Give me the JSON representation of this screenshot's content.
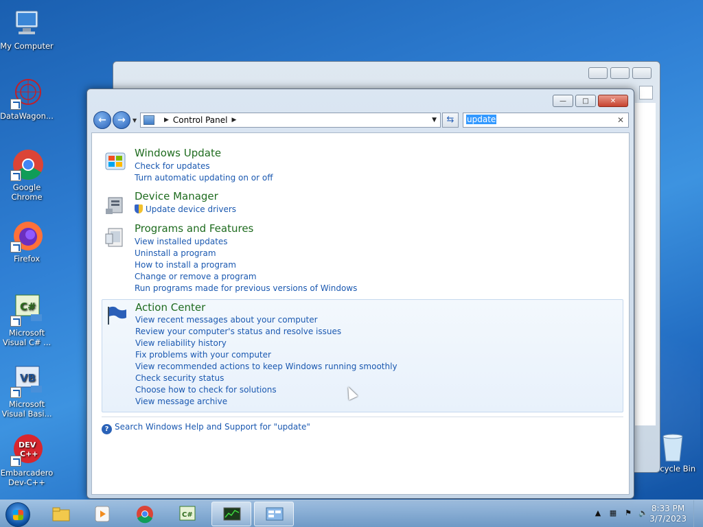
{
  "desktop": {
    "icons": [
      {
        "label": "My Computer"
      },
      {
        "label": "DataWagon..."
      },
      {
        "label": "Google Chrome"
      },
      {
        "label": "Firefox"
      },
      {
        "label": "Microsoft Visual C# ..."
      },
      {
        "label": "Microsoft Visual Basi..."
      },
      {
        "label": "Embarcadero Dev-C++"
      }
    ],
    "recycle_bin": "Recycle Bin"
  },
  "window": {
    "address": {
      "location": "Control Panel"
    },
    "search": {
      "value": "update"
    },
    "groups": [
      {
        "title": "Windows Update",
        "links": [
          "Check for updates",
          "Turn automatic updating on or off"
        ]
      },
      {
        "title": "Device Manager",
        "links": [
          "Update device drivers"
        ]
      },
      {
        "title": "Programs and Features",
        "links": [
          "View installed updates",
          "Uninstall a program",
          "How to install a program",
          "Change or remove a program",
          "Run programs made for previous versions of Windows"
        ]
      },
      {
        "title": "Action Center",
        "links": [
          "View recent messages about your computer",
          "Review your computer's status and resolve issues",
          "View reliability history",
          "Fix problems with your computer",
          "View recommended actions to keep Windows running smoothly",
          "Check security status",
          "Choose how to check for solutions",
          "View message archive"
        ]
      }
    ],
    "help_link": "Search Windows Help and Support for \"update\""
  },
  "taskbar": {
    "time": "8:33 PM",
    "date": "3/7/2023"
  }
}
